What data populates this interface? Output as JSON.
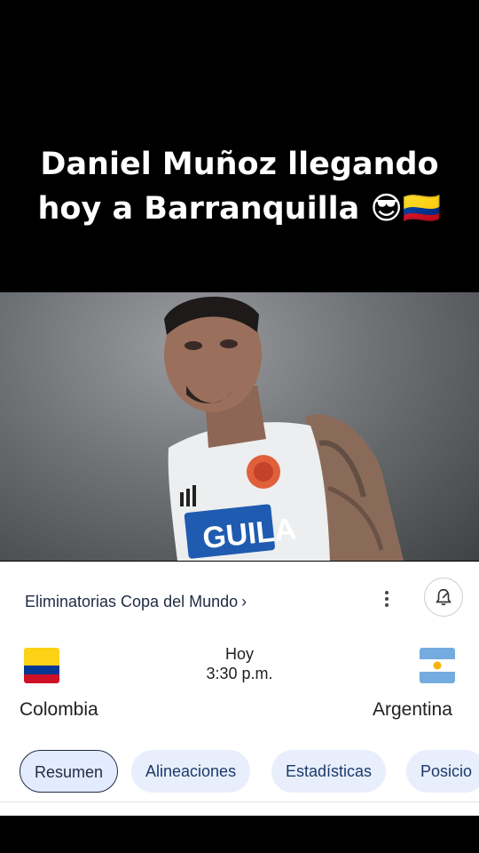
{
  "caption": {
    "line1": "Daniel Muñoz llegando",
    "line2": "hoy a Barranquilla 😎🇨🇴"
  },
  "video": {
    "shirt_text": "GUILA"
  },
  "match": {
    "competition": "Eliminatorias Copa del Mundo",
    "chevron": "›",
    "day": "Hoy",
    "time": "3:30 p.m.",
    "home": "Colombia",
    "away": "Argentina"
  },
  "tabs": [
    "Resumen",
    "Alineaciones",
    "Estadísticas",
    "Posicio"
  ],
  "icons": {
    "more": "more-vert-icon",
    "bell": "bell-edit-icon"
  },
  "colors": {
    "colombia": [
      "#FCD116",
      "#003893",
      "#CE1126"
    ],
    "argentina": [
      "#74ACDF",
      "#FFFFFF",
      "#F6B40E"
    ]
  }
}
